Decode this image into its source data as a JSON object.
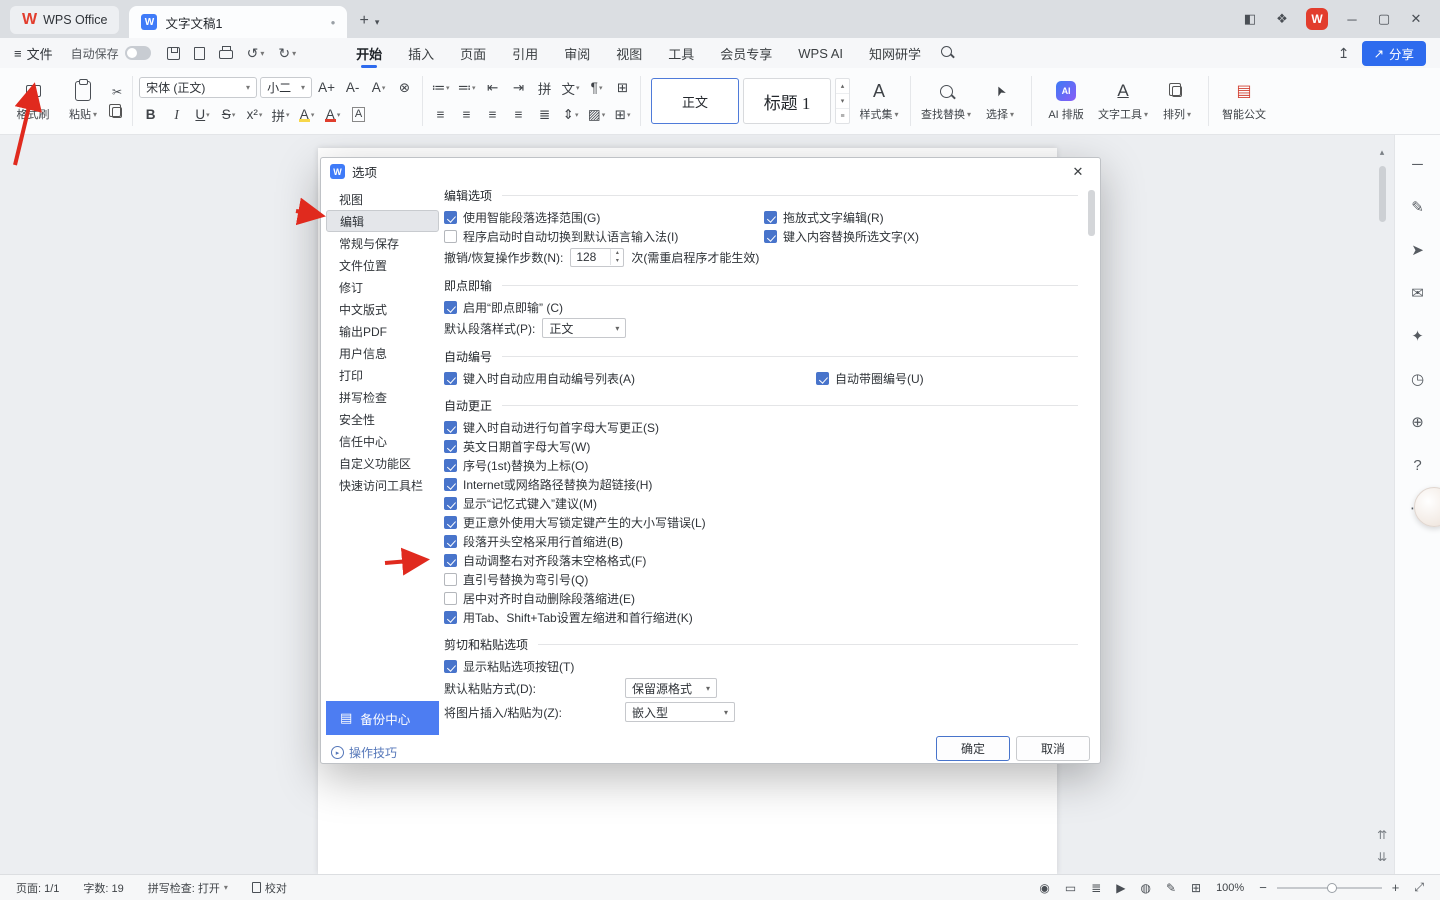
{
  "colors": {
    "accent_blue": "#2e6bee",
    "check_blue": "#4874cb",
    "backup_blue": "#4d7df2",
    "arrow_red": "#e02a1e",
    "logo_red": "#e23d2d"
  },
  "brand": {
    "wps_letter": "W",
    "app_name": "WPS Office"
  },
  "titlebar": {
    "doc_tab": "文字文稿1"
  },
  "window": {
    "layout_icon": "◧",
    "apps_icon": "❖",
    "minimize": "─",
    "maximize": "▢",
    "close": "✕"
  },
  "icons": {
    "hamburger": "≡",
    "caret": "▾",
    "caret_up": "▴",
    "undo": "↺",
    "redo": "↻",
    "scissors": "✂",
    "upload": "↥",
    "share_arrow": "↗",
    "ai_spark": "✦",
    "bold": "B",
    "italic": "I",
    "underline": "U",
    "strike": "S",
    "superscript": "x²",
    "pinyin": "拼",
    "highlight": "A",
    "font_color": "A",
    "char_border": "A",
    "font_grow": "A+",
    "font_shrink": "A-",
    "text_effect": "A",
    "clear_format": "⊗",
    "bullets": "≔",
    "numbering": "≕",
    "outdent": "⇤",
    "indent": "⇥",
    "convert": "文",
    "para_mark": "¶",
    "page_grid": "⊞",
    "align": "≡",
    "distribute": "≣",
    "line_spacing": "⇕",
    "shading": "▨",
    "borders": "⊞",
    "styles_a": "A",
    "cursor": "➤",
    "doc": "▤",
    "dot": "●",
    "plus": "+",
    "minus": "−",
    "gallery_menu": "≡",
    "fullscreen": "⤢",
    "fit": "⊞",
    "scroll_pgup": "⇈",
    "scroll_pgdn": "⇊",
    "question": "?",
    "play_circle": "▸"
  },
  "menubar": {
    "file_label": "文件",
    "autosave_label": "自动保存",
    "tabs": [
      {
        "label": "开始",
        "active": true
      },
      {
        "label": "插入"
      },
      {
        "label": "页面"
      },
      {
        "label": "引用"
      },
      {
        "label": "审阅"
      },
      {
        "label": "视图"
      },
      {
        "label": "工具"
      },
      {
        "label": "会员专享"
      },
      {
        "label": "WPS AI",
        "ai": true
      },
      {
        "label": "知网研学"
      }
    ],
    "share_label": "分享"
  },
  "ribbon": {
    "format_painter": "格式刷",
    "paste": "粘贴",
    "font_name": "宋体 (正文)",
    "font_size": "小二",
    "style_normal": "正文",
    "style_heading": "标题 1",
    "style_set": "样式集",
    "find_replace": "查找替换",
    "select": "选择",
    "ai_layout": "AI 排版",
    "text_tool": "文字工具",
    "arrange": "排列",
    "smart_doc": "智能公文",
    "ai_badge": "AI"
  },
  "dialog": {
    "title": "选项",
    "sidebar": [
      {
        "label": "视图"
      },
      {
        "label": "编辑",
        "selected": true
      },
      {
        "label": "常规与保存"
      },
      {
        "label": "文件位置"
      },
      {
        "label": "修订"
      },
      {
        "label": "中文版式"
      },
      {
        "label": "输出PDF"
      },
      {
        "label": "用户信息"
      },
      {
        "label": "打印"
      },
      {
        "label": "拼写检查"
      },
      {
        "label": "安全性"
      },
      {
        "label": "信任中心"
      },
      {
        "label": "自定义功能区"
      },
      {
        "label": "快速访问工具栏"
      }
    ],
    "backup_center": "备份中心",
    "tips_link": "操作技巧",
    "ok_button": "确定",
    "cancel_button": "取消",
    "sections": {
      "edit_options": {
        "title": "编辑选项",
        "left": [
          {
            "label": "使用智能段落选择范围(G)",
            "checked": true
          },
          {
            "label": "程序启动时自动切换到默认语言输入法(I)",
            "checked": false
          }
        ],
        "right": [
          {
            "label": "拖放式文字编辑(R)",
            "checked": true
          },
          {
            "label": "键入内容替换所选文字(X)",
            "checked": true
          }
        ],
        "undo_label": "撤销/恢复操作步数(N):",
        "undo_value": "128",
        "undo_suffix": "次(需重启程序才能生效)"
      },
      "click_type": {
        "title": "即点即输",
        "items": [
          {
            "label": "启用“即点即输” (C)",
            "checked": true
          }
        ],
        "style_label": "默认段落样式(P):",
        "style_value": "正文"
      },
      "auto_number": {
        "title": "自动编号",
        "left": [
          {
            "label": "键入时自动应用自动编号列表(A)",
            "checked": true
          }
        ],
        "right": [
          {
            "label": "自动带圈编号(U)",
            "checked": true
          }
        ]
      },
      "auto_correct": {
        "title": "自动更正",
        "items": [
          {
            "label": "键入时自动进行句首字母大写更正(S)",
            "checked": true
          },
          {
            "label": "英文日期首字母大写(W)",
            "checked": true
          },
          {
            "label": "序号(1st)替换为上标(O)",
            "checked": true
          },
          {
            "label": "Internet或网络路径替换为超链接(H)",
            "checked": true
          },
          {
            "label": "显示“记忆式键入”建议(M)",
            "checked": true
          },
          {
            "label": "更正意外使用大写锁定键产生的大小写错误(L)",
            "checked": true
          },
          {
            "label": "段落开头空格采用行首缩进(B)",
            "checked": true
          },
          {
            "label": "自动调整右对齐段落末空格格式(F)",
            "checked": true
          },
          {
            "label": "直引号替换为弯引号(Q)",
            "checked": false
          },
          {
            "label": "居中对齐时自动删除段落缩进(E)",
            "checked": false
          },
          {
            "label": "用Tab、Shift+Tab设置左缩进和首行缩进(K)",
            "checked": true
          }
        ]
      },
      "cut_paste": {
        "title": "剪切和粘贴选项",
        "items": [
          {
            "label": "显示粘贴选项按钮(T)",
            "checked": true
          }
        ],
        "paste_label": "默认粘贴方式(D):",
        "paste_value": "保留源格式",
        "image_label": "将图片插入/粘贴为(Z):",
        "image_value": "嵌入型"
      }
    }
  },
  "side_panel": {
    "tools": [
      {
        "name": "collapse-icon",
        "glyph": "─"
      },
      {
        "name": "pen-icon",
        "glyph": "✎"
      },
      {
        "name": "cursor-icon",
        "glyph": "➤"
      },
      {
        "name": "comment-icon",
        "glyph": "✉"
      },
      {
        "name": "sparkle-icon",
        "glyph": "✦"
      },
      {
        "name": "history-icon",
        "glyph": "◷"
      },
      {
        "name": "contact-icon",
        "glyph": "⊕"
      },
      {
        "name": "help-icon",
        "glyph": "?"
      },
      {
        "name": "more-icon",
        "glyph": "⋯"
      }
    ]
  },
  "statusbar": {
    "page": "页面: 1/1",
    "words": "字数: 19",
    "spellcheck": "拼写检查: 打开",
    "proof": "校对",
    "zoom": "100%",
    "view_tools": [
      {
        "name": "eye-icon",
        "glyph": "◉"
      },
      {
        "name": "page-view-icon",
        "glyph": "▭"
      },
      {
        "name": "outline-view-icon",
        "glyph": "≣"
      },
      {
        "name": "read-mode-icon",
        "glyph": "▶"
      },
      {
        "name": "web-view-icon",
        "glyph": "◍"
      },
      {
        "name": "ink-icon",
        "glyph": "✎"
      }
    ]
  }
}
